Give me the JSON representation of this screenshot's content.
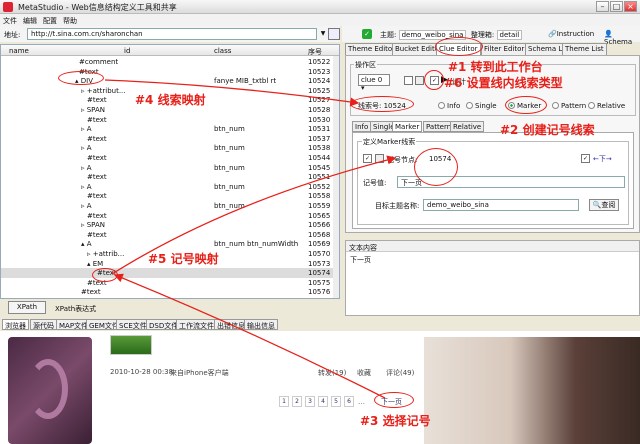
{
  "window": {
    "title": "MetaStudio - Web信息结构定义工具和共享"
  },
  "menu": [
    "文件",
    "编辑",
    "配置",
    "帮助"
  ],
  "address": {
    "label": "地址:",
    "url": "http://t.sina.com.cn/sharonchan"
  },
  "topbar": {
    "theme_label": "主题:",
    "theme_value": "demo_weibo_sina",
    "organizer_label": "整理箱:",
    "organizer_value": "detail",
    "instruction": "Instruction",
    "schema": "Schema"
  },
  "tree": {
    "columns": {
      "name": "name",
      "id": "id",
      "class": "class",
      "seq": "序号"
    },
    "rows": [
      {
        "name": "#comment",
        "indent": 78,
        "cls": "",
        "seq": "10522"
      },
      {
        "name": "#text",
        "indent": 78,
        "cls": "",
        "seq": "10523"
      },
      {
        "name": "DIV",
        "indent": 74,
        "prefix": "▴",
        "cls": "fanye MIB_txtbl rt",
        "seq": "10524"
      },
      {
        "name": "+attribut...",
        "indent": 80,
        "prefix": "▹",
        "cls": "",
        "seq": "10525"
      },
      {
        "name": "#text",
        "indent": 86,
        "cls": "",
        "seq": "10527"
      },
      {
        "name": "SPAN",
        "indent": 80,
        "prefix": "▹",
        "cls": "",
        "seq": "10528"
      },
      {
        "name": "#text",
        "indent": 86,
        "cls": "",
        "seq": "10530"
      },
      {
        "name": "A",
        "indent": 80,
        "prefix": "▹",
        "cls": "btn_num",
        "seq": "10531"
      },
      {
        "name": "#text",
        "indent": 86,
        "cls": "",
        "seq": "10537"
      },
      {
        "name": "A",
        "indent": 80,
        "prefix": "▹",
        "cls": "btn_num",
        "seq": "10538"
      },
      {
        "name": "#text",
        "indent": 86,
        "cls": "",
        "seq": "10544"
      },
      {
        "name": "A",
        "indent": 80,
        "prefix": "▹",
        "cls": "btn_num",
        "seq": "10545"
      },
      {
        "name": "#text",
        "indent": 86,
        "cls": "",
        "seq": "10551"
      },
      {
        "name": "A",
        "indent": 80,
        "prefix": "▹",
        "cls": "btn_num",
        "seq": "10552"
      },
      {
        "name": "#text",
        "indent": 86,
        "cls": "",
        "seq": "10558"
      },
      {
        "name": "A",
        "indent": 80,
        "prefix": "▹",
        "cls": "btn_num",
        "seq": "10559"
      },
      {
        "name": "#text",
        "indent": 86,
        "cls": "",
        "seq": "10565"
      },
      {
        "name": "SPAN",
        "indent": 80,
        "prefix": "▹",
        "cls": "",
        "seq": "10566"
      },
      {
        "name": "#text",
        "indent": 86,
        "cls": "",
        "seq": "10568"
      },
      {
        "name": "A",
        "indent": 80,
        "prefix": "▴",
        "cls": "btn_num btn_numWidth",
        "seq": "10569"
      },
      {
        "name": "+attrib...",
        "indent": 86,
        "prefix": "▹",
        "cls": "",
        "seq": "10570"
      },
      {
        "name": "EM",
        "indent": 86,
        "prefix": "▴",
        "cls": "",
        "seq": "10573"
      },
      {
        "name": "#text",
        "indent": 96,
        "cls": "",
        "seq": "10574",
        "selected": true
      },
      {
        "name": "#text",
        "indent": 86,
        "cls": "",
        "seq": "10575"
      },
      {
        "name": "#text",
        "indent": 80,
        "cls": "",
        "seq": "10576"
      }
    ]
  },
  "xpath": {
    "button": "XPath",
    "label": "XPath表达式"
  },
  "right_tabs": [
    "Theme Editor",
    "Bucket Editor",
    "Clue Editor",
    "Filter Editor",
    "Schema List",
    "Theme List"
  ],
  "clue": {
    "ops_label": "操作区",
    "clue_select": "clue 0",
    "set_label": "设计",
    "clue_no_label": "线索号:",
    "clue_no": "10524",
    "modes": [
      "Info",
      "Single",
      "Marker",
      "Pattern",
      "Relative"
    ],
    "selected_mode": "Marker",
    "subtabs": [
      "Info",
      "Single",
      "Marker",
      "Pattern",
      "Relative"
    ],
    "marker_group": "定义Marker线索",
    "marker_no_label": "记号节点:",
    "marker_no": "10574",
    "marker_value_label": "记号值:",
    "marker_value": "下一页",
    "target_label": "目标主题名称:",
    "target_value": "demo_weibo_sina",
    "find_button": "查阅",
    "arrow_icon_text": "←下→"
  },
  "textpane": {
    "header": "文本内容",
    "content": "下一页"
  },
  "bottom_tabs": [
    "浏览器",
    "源代码",
    "MAP文件",
    "GEM文件",
    "SCE文件",
    "DSD文件",
    "工作流文件",
    "出错信息",
    "输出信息"
  ],
  "browser": {
    "meta_time": "2010-10-28 00:38",
    "meta_source": "来自iPhone客户端",
    "repost": "转发(19)",
    "fav": "收藏",
    "comment": "评论(49)",
    "pages": [
      "1",
      "2",
      "3",
      "4",
      "5",
      "6"
    ],
    "next": "下一页"
  },
  "annotations": {
    "a1": "#1 转到此工作台",
    "a2": "#2 创建记号线索",
    "a3": "#3 选择记号",
    "a4": "#4 线索映射",
    "a5": "#5 记号映射",
    "a6": "#6 设置线内线索类型"
  },
  "colors": {
    "annotation": "#e8201a",
    "accent": "#2a5"
  }
}
